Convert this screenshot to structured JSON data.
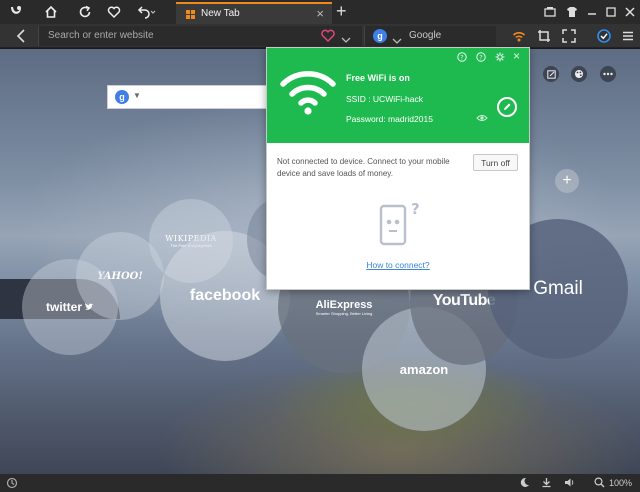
{
  "browser": {
    "tab_title": "New Tab",
    "tab_close": "×",
    "new_tab": "+",
    "address_placeholder": "Search or enter website",
    "search_engine": "Google",
    "search_engine_badge": "g",
    "zoom": "100%"
  },
  "newtab_page": {
    "search_badge": "g",
    "add_site": "+",
    "sites": [
      {
        "name": "wikipedia",
        "label": "WIKIPEDIA",
        "sub": "The Free Encyclopedia"
      },
      {
        "name": "yahoo",
        "label": "YAHOO!"
      },
      {
        "name": "twitter",
        "label": "twitter"
      },
      {
        "name": "facebook",
        "label": "facebook"
      },
      {
        "name": "aliexpress",
        "label": "AliExpress",
        "sub": "Smarter Shopping, Better Living"
      },
      {
        "name": "amazon",
        "label": "amazon"
      },
      {
        "name": "youtube",
        "label": "YouTube"
      },
      {
        "name": "gmail",
        "label": "Gmail"
      }
    ]
  },
  "wifi_popup": {
    "title": "Free WiFi is on",
    "ssid": "SSID : UCWiFi-hack",
    "password": "Password: madrid2015",
    "message": "Not connected to device. Connect to your mobile device and save loads of money.",
    "turn_off": "Turn off",
    "how_to": "How to connect?",
    "phone_mark": "?",
    "close": "×",
    "colors": {
      "accent": "#1fba4f",
      "link": "#3d84d6"
    }
  },
  "colors": {
    "tab_accent": "#f08a1b",
    "toolbar": "#333333",
    "chrome": "#2a2a2a"
  }
}
